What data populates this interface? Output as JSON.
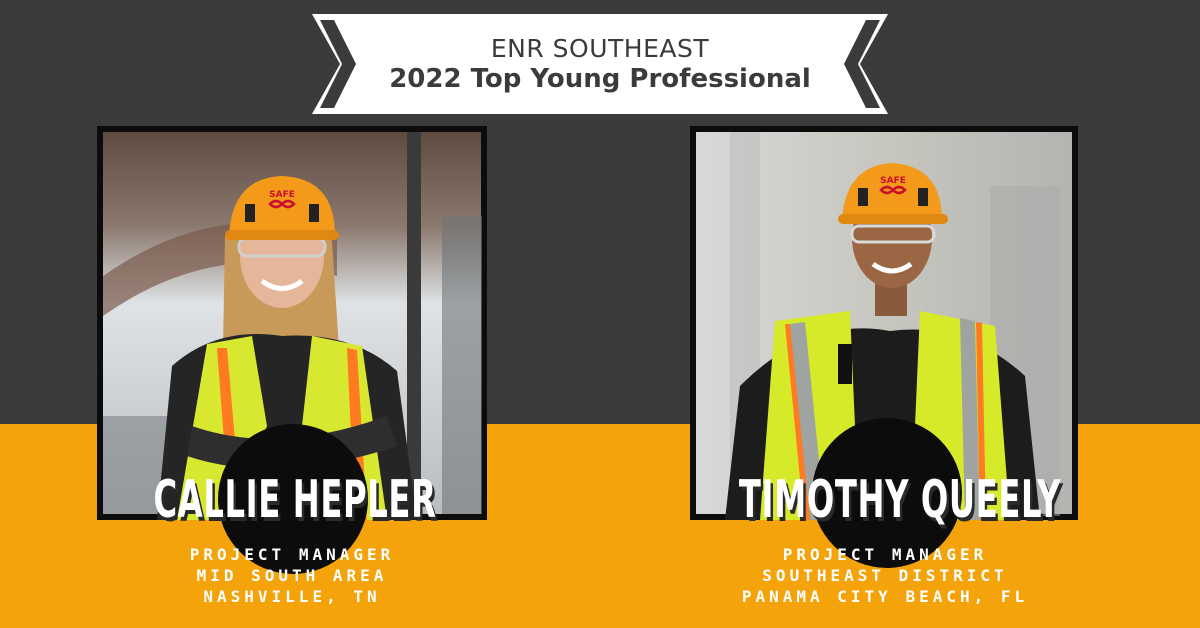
{
  "banner": {
    "line1": "ENR SOUTHEAST",
    "line2": "2022 Top Young Professional"
  },
  "honorees": [
    {
      "name": "CALLIE HEPLER",
      "title": "PROJECT MANAGER",
      "area": "MID SOUTH AREA",
      "location": "NASHVILLE, TN"
    },
    {
      "name": "TIMOTHY QUEELY",
      "title": "PROJECT MANAGER",
      "area": "SOUTHEAST DISTRICT",
      "location": "PANAMA CITY BEACH, FL"
    }
  ],
  "colors": {
    "dark_band": "#3b3b3b",
    "accent_band": "#f4a30b",
    "helmet": "#f39a1a",
    "vest": "#d8e830",
    "frame": "#0c0c0c"
  },
  "icons": [
    "helmet-logo-icon",
    "helmet-logo-icon"
  ]
}
